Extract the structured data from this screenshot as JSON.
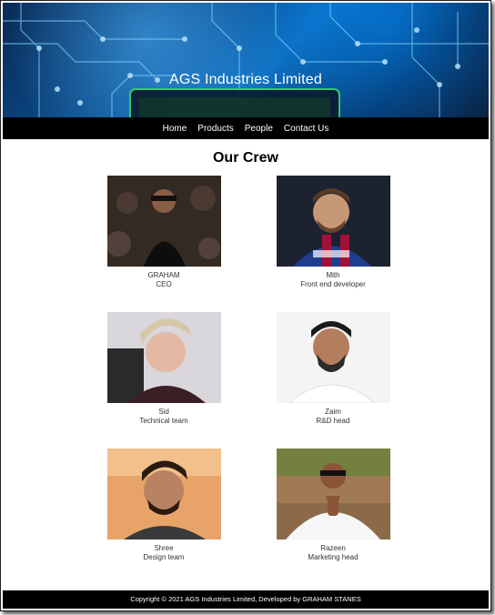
{
  "banner": {
    "title": "AGS Industries Limited"
  },
  "nav": {
    "items": [
      "Home",
      "Products",
      "People",
      "Contact Us"
    ]
  },
  "crew": {
    "heading": "Our Crew",
    "members": [
      {
        "name": "GRAHAM",
        "role": "CEO"
      },
      {
        "name": "Mith",
        "role": "Front end developer"
      },
      {
        "name": "Sid",
        "role": "Technical team"
      },
      {
        "name": "Zaim",
        "role": "R&D head"
      },
      {
        "name": "Shree",
        "role": "Design team"
      },
      {
        "name": "Razeen",
        "role": "Marketing head"
      }
    ]
  },
  "footer": {
    "text": "Copyright © 2021 AGS Industries Limited, Developed by GRAHAM STANES"
  }
}
